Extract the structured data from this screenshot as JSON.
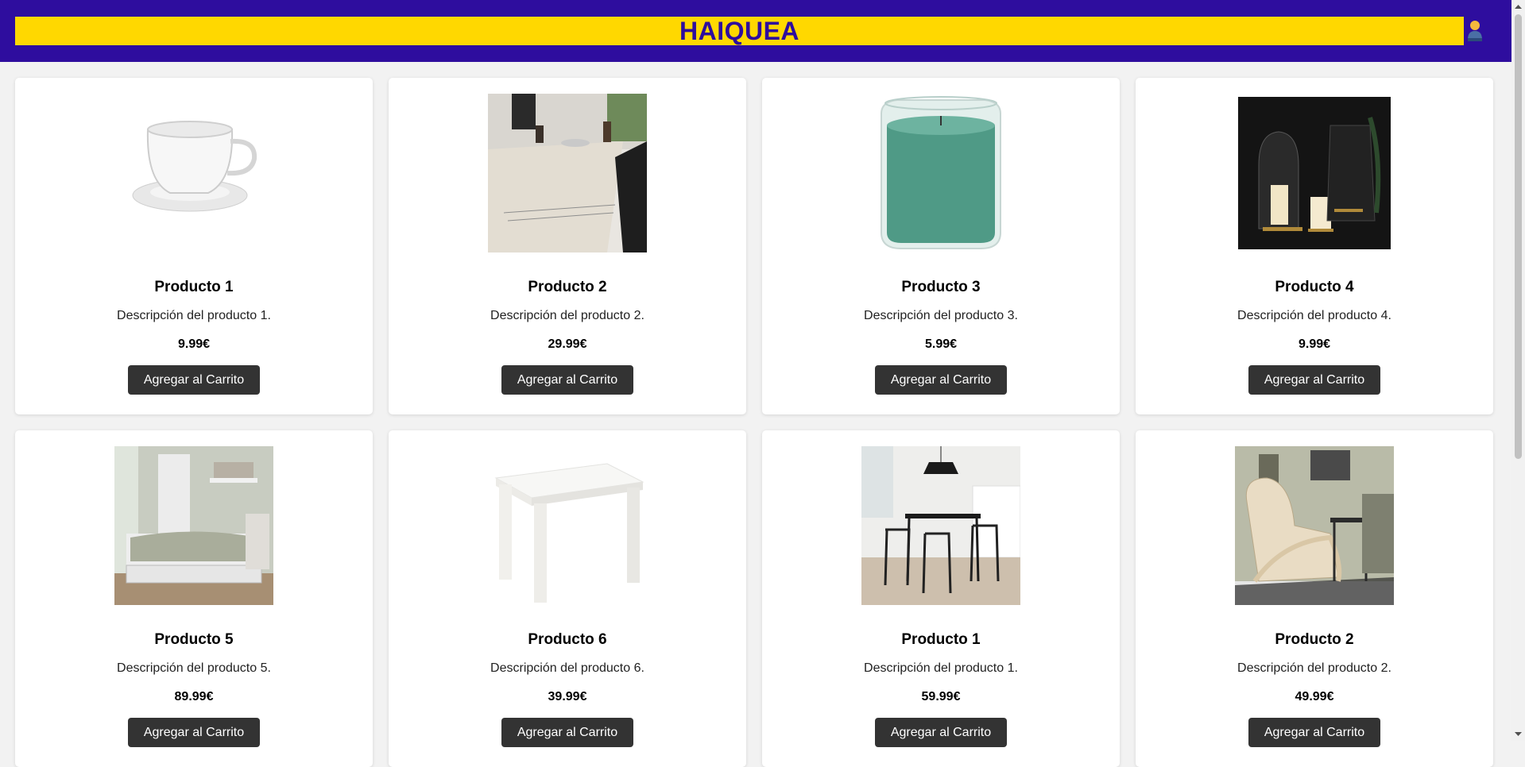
{
  "header": {
    "title": "HAIQUEA",
    "user_icon": "user-avatar-icon",
    "colors": {
      "background": "#2e0d9e",
      "title_bar": "#ffd800",
      "title_text": "#2e0d9e"
    }
  },
  "products": [
    {
      "name": "Producto 1",
      "description": "Descripción del producto 1.",
      "price": "9.99€",
      "button": "Agregar al Carrito",
      "image": "teacup-image"
    },
    {
      "name": "Producto 2",
      "description": "Descripción del producto 2.",
      "price": "29.99€",
      "button": "Agregar al Carrito",
      "image": "tablecloth-image"
    },
    {
      "name": "Producto 3",
      "description": "Descripción del producto 3.",
      "price": "5.99€",
      "button": "Agregar al Carrito",
      "image": "candle-jar-image"
    },
    {
      "name": "Producto 4",
      "description": "Descripción del producto 4.",
      "price": "9.99€",
      "button": "Agregar al Carrito",
      "image": "lanterns-image"
    },
    {
      "name": "Producto 5",
      "description": "Descripción del producto 5.",
      "price": "89.99€",
      "button": "Agregar al Carrito",
      "image": "bedroom-image"
    },
    {
      "name": "Producto 6",
      "description": "Descripción del producto 6.",
      "price": "39.99€",
      "button": "Agregar al Carrito",
      "image": "side-table-image"
    },
    {
      "name": "Producto 1",
      "description": "Descripción del producto 1.",
      "price": "59.99€",
      "button": "Agregar al Carrito",
      "image": "dining-set-image"
    },
    {
      "name": "Producto 2",
      "description": "Descripción del producto 2.",
      "price": "49.99€",
      "button": "Agregar al Carrito",
      "image": "armchair-image"
    }
  ]
}
